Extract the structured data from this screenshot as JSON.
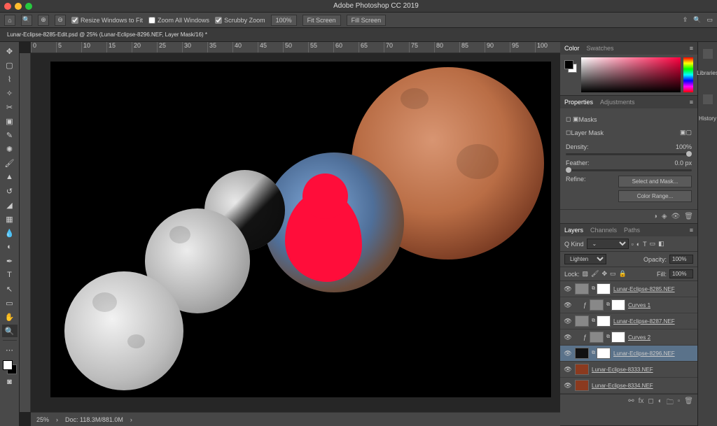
{
  "app": {
    "title": "Adobe Photoshop CC 2019"
  },
  "options": {
    "resize_windows": "Resize Windows to Fit",
    "zoom_all": "Zoom All Windows",
    "scrubby": "Scrubby Zoom",
    "zoom_pct": "100%",
    "fit_screen": "Fit Screen",
    "fill_screen": "Fill Screen"
  },
  "document": {
    "tab": "Lunar-Eclipse-8285-Edit.psd @ 25% (Lunar-Eclipse-8296.NEF, Layer Mask/16) *",
    "status_zoom": "25%",
    "status_doc": "Doc: 118.3M/881.0M"
  },
  "ruler_marks": [
    "0",
    "5",
    "10",
    "15",
    "20",
    "25",
    "30",
    "35",
    "40",
    "45",
    "50",
    "55",
    "60",
    "65",
    "70",
    "75",
    "80",
    "85",
    "90",
    "95",
    "100"
  ],
  "panel_color": {
    "tab1": "Color",
    "tab2": "Swatches"
  },
  "panel_props": {
    "tab1": "Properties",
    "tab2": "Adjustments",
    "title": "Masks",
    "layer_mask": "Layer Mask",
    "density_label": "Density:",
    "density_val": "100%",
    "feather_label": "Feather:",
    "feather_val": "0.0 px",
    "refine_label": "Refine:",
    "select_mask": "Select and Mask...",
    "color_range": "Color Range..."
  },
  "panel_layers": {
    "tab1": "Layers",
    "tab2": "Channels",
    "tab3": "Paths",
    "kind": "Kind",
    "blend": "Lighten",
    "opacity_label": "Opacity:",
    "opacity": "100%",
    "lock": "Lock:",
    "fill_label": "Fill:",
    "fill": "100%",
    "items": [
      {
        "name": "Lunar-Eclipse-8285.NEF",
        "sel": false,
        "mask": true,
        "thumb": "gray"
      },
      {
        "name": "Curves 1",
        "sel": false,
        "mask": true,
        "curve": true
      },
      {
        "name": "Lunar-Eclipse-8287.NEF",
        "sel": false,
        "mask": true,
        "thumb": "gray"
      },
      {
        "name": "Curves 2",
        "sel": false,
        "mask": true,
        "curve": true
      },
      {
        "name": "Lunar-Eclipse-8296.NEF",
        "sel": true,
        "mask": true,
        "thumb": "dark"
      },
      {
        "name": "Lunar-Eclipse-8333.NEF",
        "sel": false,
        "mask": false,
        "thumb": "red"
      },
      {
        "name": "Lunar-Eclipse-8334.NEF",
        "sel": false,
        "mask": false,
        "thumb": "red"
      }
    ]
  },
  "sidebar": {
    "libraries": "Libraries",
    "history": "History"
  },
  "filter_label": "Q Kind"
}
